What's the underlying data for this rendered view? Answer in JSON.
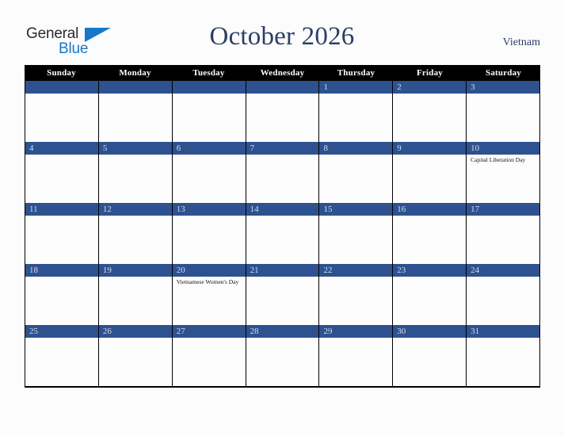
{
  "brand": {
    "name_part1": "General",
    "name_part2": "Blue",
    "triangle_icon": "triangle-icon",
    "color_primary": "#1878c8",
    "color_text": "#2b2b2b"
  },
  "header": {
    "title": "October 2026",
    "country": "Vietnam",
    "title_color": "#2b3f63"
  },
  "theme": {
    "weekday_header_bg": "#000000",
    "weekday_header_text": "#ffffff",
    "daynum_bar_bg": "#2e5190",
    "daynum_text": "#d9dde6",
    "cell_bg": "#ffffff",
    "border": "#000000",
    "page_bg": "#fcfcfd"
  },
  "weekdays": [
    "Sunday",
    "Monday",
    "Tuesday",
    "Wednesday",
    "Thursday",
    "Friday",
    "Saturday"
  ],
  "weeks": [
    [
      {
        "day": "",
        "holiday": ""
      },
      {
        "day": "",
        "holiday": ""
      },
      {
        "day": "",
        "holiday": ""
      },
      {
        "day": "",
        "holiday": ""
      },
      {
        "day": "1",
        "holiday": ""
      },
      {
        "day": "2",
        "holiday": ""
      },
      {
        "day": "3",
        "holiday": ""
      }
    ],
    [
      {
        "day": "4",
        "holiday": ""
      },
      {
        "day": "5",
        "holiday": ""
      },
      {
        "day": "6",
        "holiday": ""
      },
      {
        "day": "7",
        "holiday": ""
      },
      {
        "day": "8",
        "holiday": ""
      },
      {
        "day": "9",
        "holiday": ""
      },
      {
        "day": "10",
        "holiday": "Capital Liberation Day"
      }
    ],
    [
      {
        "day": "11",
        "holiday": ""
      },
      {
        "day": "12",
        "holiday": ""
      },
      {
        "day": "13",
        "holiday": ""
      },
      {
        "day": "14",
        "holiday": ""
      },
      {
        "day": "15",
        "holiday": ""
      },
      {
        "day": "16",
        "holiday": ""
      },
      {
        "day": "17",
        "holiday": ""
      }
    ],
    [
      {
        "day": "18",
        "holiday": ""
      },
      {
        "day": "19",
        "holiday": ""
      },
      {
        "day": "20",
        "holiday": "Vietnamese Women's Day"
      },
      {
        "day": "21",
        "holiday": ""
      },
      {
        "day": "22",
        "holiday": ""
      },
      {
        "day": "23",
        "holiday": ""
      },
      {
        "day": "24",
        "holiday": ""
      }
    ],
    [
      {
        "day": "25",
        "holiday": ""
      },
      {
        "day": "26",
        "holiday": ""
      },
      {
        "day": "27",
        "holiday": ""
      },
      {
        "day": "28",
        "holiday": ""
      },
      {
        "day": "29",
        "holiday": ""
      },
      {
        "day": "30",
        "holiday": ""
      },
      {
        "day": "31",
        "holiday": ""
      }
    ]
  ]
}
